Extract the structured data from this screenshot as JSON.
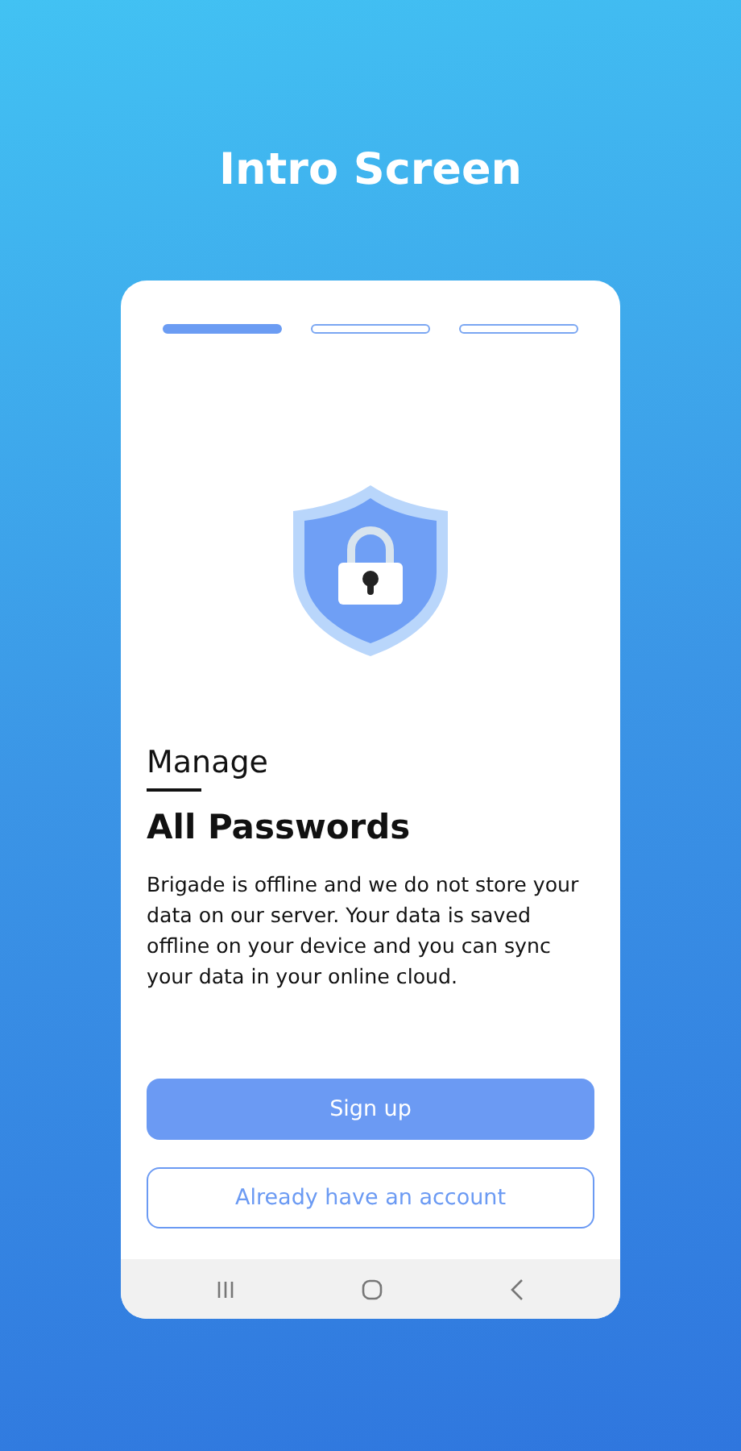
{
  "title": "Intro Screen",
  "steps": [
    {
      "selected": true
    },
    {
      "selected": false
    },
    {
      "selected": false
    }
  ],
  "subtitle": "Manage",
  "heading": "All Passwords",
  "description": "Brigade is offline and we do not store your data on our server. Your data is saved offline on your device and you can sync your data in your online cloud.",
  "buttons": [
    {
      "label": "Sign up",
      "kind": "primary"
    },
    {
      "label": "Already have an account",
      "kind": "outline"
    }
  ]
}
